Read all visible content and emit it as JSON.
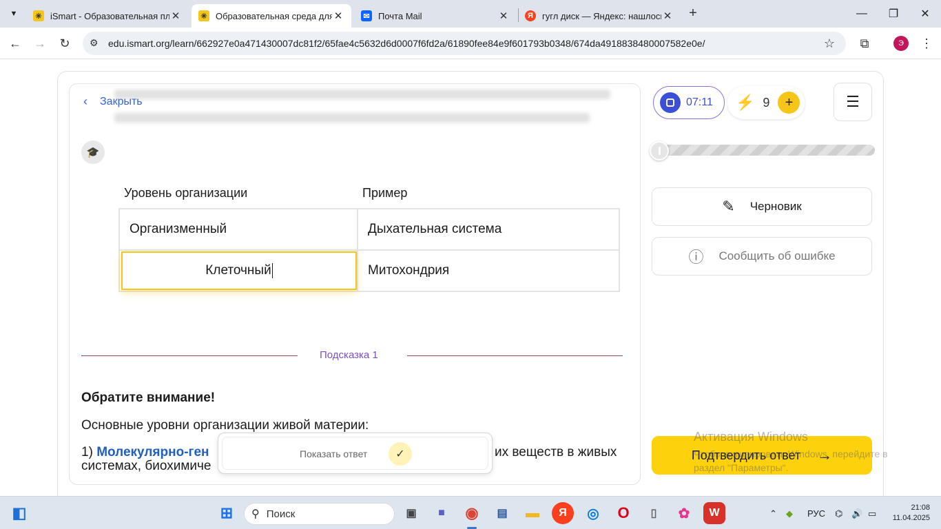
{
  "browser": {
    "tabs": [
      {
        "title": "iSmart - Образовательная пла",
        "active": false
      },
      {
        "title": "Образовательная среда для са",
        "active": true
      },
      {
        "title": "Почта Mail",
        "active": false
      },
      {
        "title": "гугл диск — Яндекс: нашлось",
        "active": false
      }
    ],
    "url": "edu.ismart.org/learn/662927e0a471430007dc81f2/65fae4c5632d6d0007f6fd2a/61890fee84e9f601793b0348/674da4918838480007582e0e/",
    "profile_letter": "Э"
  },
  "task": {
    "close_label": "Закрыть",
    "table": {
      "headers": [
        "Уровень организации",
        "Пример"
      ],
      "rows": [
        [
          "Организменный",
          "Дыхательная система"
        ],
        [
          "Клеточный",
          "Митохондрия"
        ]
      ]
    },
    "hint_label": "Подсказка  1",
    "attention": "Обратите внимание!",
    "levels_intro": "Основные уровни организации живой материи:",
    "molecular_prefix": "1) ",
    "molecular_term": "Молекулярно-ген",
    "molecular_rest_line1": "их веществ в живых",
    "molecular_line2": "системах, биохимиче",
    "show_answer": "Показать ответ"
  },
  "sidebar": {
    "timer": "07:11",
    "energy": "9",
    "progress_fraction": 0.0,
    "draft_label": "Черновик",
    "report_label": "Сообщить об ошибке",
    "confirm_label": "Подтвердить ответ"
  },
  "watermark": {
    "line1": "Активация Windows",
    "line2": "Чтобы активировать Windows, перейдите в раздел \"Параметры\"."
  },
  "taskbar": {
    "search_label": "Поиск",
    "lang": "РУС",
    "time": "21:08",
    "date": "11.04.2025"
  },
  "colors": {
    "accent_yellow": "#fdd20d",
    "link_blue": "#3565d4",
    "timer_blue": "#3c4fd8",
    "hint_purple": "#7b4fc9"
  }
}
